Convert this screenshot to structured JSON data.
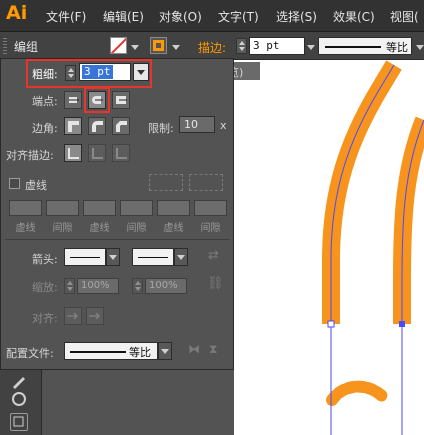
{
  "app": {
    "logo": "Ai"
  },
  "menu": [
    "文件(F)",
    "编辑(E)",
    "对象(O)",
    "文字(T)",
    "选择(S)",
    "效果(C)",
    "视图("
  ],
  "control_bar": {
    "selection_label": "编组",
    "stroke_label": "描边:",
    "stroke_value": "3 pt",
    "profile_label": "等比"
  },
  "document_tab": {
    "partial_label": "览)"
  },
  "stroke_panel": {
    "weight_label": "粗细:",
    "weight_value": "3 pt",
    "cap_label": "端点:",
    "corner_label": "边角:",
    "limit_label": "限制:",
    "limit_value": "10",
    "limit_unit": "x",
    "align_label": "对齐描边:",
    "dashed_label": "虚线",
    "dash_fields": [
      "虚线",
      "间隙",
      "虚线",
      "间隙",
      "虚线",
      "间隙"
    ],
    "arrowhead_label": "箭头:",
    "scale_label": "缩放:",
    "scale_start": "100%",
    "scale_end": "100%",
    "align_arrow_label": "对齐:",
    "profile_label": "配置文件:",
    "profile_value": "等比"
  },
  "colors": {
    "accent": "#ff9a00",
    "highlight": "#e8352b",
    "path": "#f7941d",
    "path_line": "#4a4aff"
  }
}
